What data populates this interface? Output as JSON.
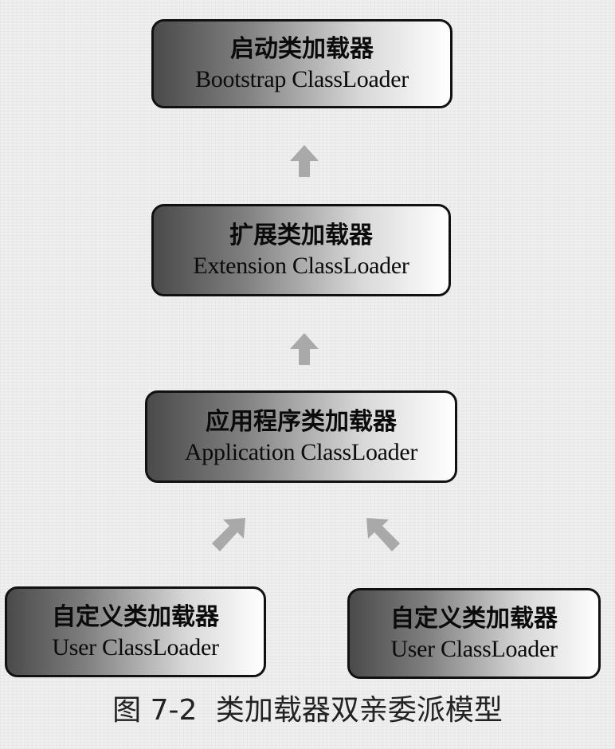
{
  "diagram": {
    "bootstrap": {
      "zh": "启动类加载器",
      "en": "Bootstrap ClassLoader"
    },
    "extension": {
      "zh": "扩展类加载器",
      "en": "Extension ClassLoader"
    },
    "application": {
      "zh": "应用程序类加载器",
      "en": "Application ClassLoader"
    },
    "user_left": {
      "zh": "自定义类加载器",
      "en": "User ClassLoader"
    },
    "user_right": {
      "zh": "自定义类加载器",
      "en": "User ClassLoader"
    }
  },
  "caption": {
    "figure_no": "图 7-2",
    "text": "类加载器双亲委派模型"
  },
  "colors": {
    "box_border": "#111111",
    "gradient_dark": "#4a4a4a",
    "gradient_light": "#ffffff",
    "arrow": "#a9a9a9"
  },
  "icons": [
    "up-arrow-icon",
    "diagonal-arrow-icon"
  ]
}
